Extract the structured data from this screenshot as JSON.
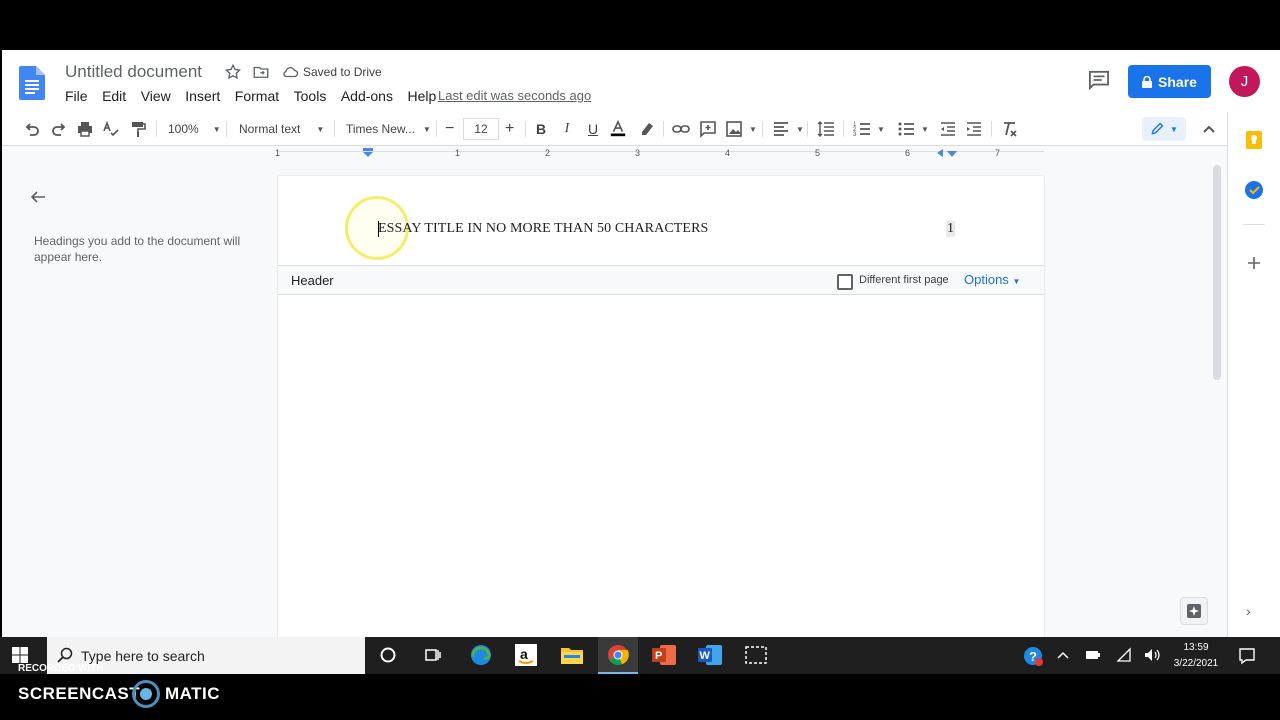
{
  "doc": {
    "title": "Untitled document",
    "saved_status": "Saved to Drive",
    "last_edit": "Last edit was seconds ago",
    "share_label": "Share",
    "avatar_initial": "J"
  },
  "menu": [
    "File",
    "Edit",
    "View",
    "Insert",
    "Format",
    "Tools",
    "Add-ons",
    "Help"
  ],
  "toolbar": {
    "zoom": "100%",
    "style": "Normal text",
    "font": "Times New...",
    "font_size": "12",
    "minus": "−",
    "plus": "+"
  },
  "ruler": {
    "numbers": [
      "1",
      "1",
      "2",
      "3",
      "4",
      "5",
      "6",
      "7"
    ]
  },
  "outline": {
    "hint": "Headings you add to the document will appear here."
  },
  "page": {
    "header_text": "ESSAY TITLE IN NO MORE THAN 50 CHARACTERS",
    "page_number": "1",
    "header_label": "Header",
    "different_first_page": "Different first page",
    "options_label": "Options"
  },
  "taskbar": {
    "search_placeholder": "Type here to search",
    "time": "13:59",
    "date": "3/22/2021"
  },
  "watermark": {
    "recorded_with": "RECORDED WITH",
    "brand_left": "SCREENCAST",
    "brand_right": "MATIC"
  },
  "colors": {
    "accent": "#1a73e8",
    "avatar": "#c2185b",
    "docs_blue": "#4285f4"
  }
}
